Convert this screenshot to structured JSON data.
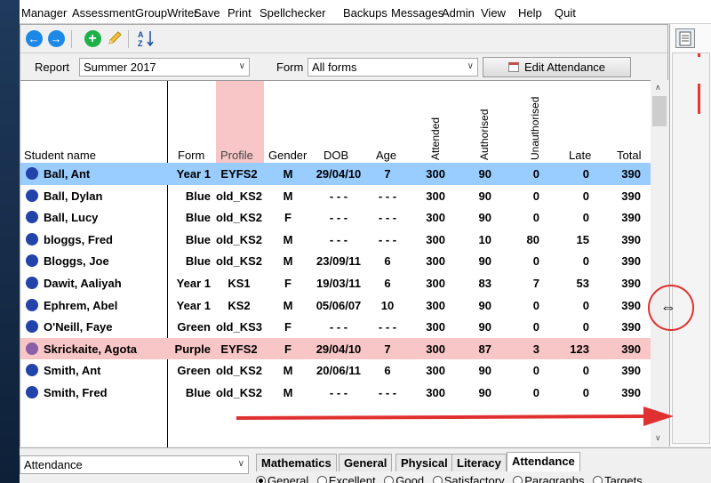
{
  "menu": [
    "Manager",
    "Assessment",
    "GroupWriter",
    "Save",
    "Print",
    "Spellchecker",
    "Backups",
    "Messages",
    "Admin",
    "View",
    "Help",
    "Quit"
  ],
  "filters": {
    "report_label": "Report",
    "report_value": "Summer 2017",
    "form_label": "Form",
    "form_value": "All forms",
    "edit_button": "Edit Attendance"
  },
  "columns": {
    "name": "Student name",
    "form": "Form",
    "profile": "Profile",
    "gender": "Gender",
    "dob": "DOB",
    "age": "Age",
    "attended": "Attended",
    "authorised": "Authorised",
    "unauthorised": "Unauthorised",
    "late": "Late",
    "total": "Total"
  },
  "rows": [
    {
      "name": "Ball, Ant",
      "form": "Year 1",
      "profile": "EYFS2",
      "gender": "M",
      "dob": "29/04/10",
      "age": "7",
      "attended": "300",
      "authorised": "90",
      "unauthorised": "0",
      "late": "0",
      "total": "390"
    },
    {
      "name": "Ball, Dylan",
      "form": "Blue",
      "profile": "old_KS2",
      "gender": "M",
      "dob": "- - -",
      "age": "- - -",
      "attended": "300",
      "authorised": "90",
      "unauthorised": "0",
      "late": "0",
      "total": "390"
    },
    {
      "name": "Ball, Lucy",
      "form": "Blue",
      "profile": "old_KS2",
      "gender": "F",
      "dob": "- - -",
      "age": "- - -",
      "attended": "300",
      "authorised": "90",
      "unauthorised": "0",
      "late": "0",
      "total": "390"
    },
    {
      "name": "bloggs, Fred",
      "form": "Blue",
      "profile": "old_KS2",
      "gender": "M",
      "dob": "- - -",
      "age": "- - -",
      "attended": "300",
      "authorised": "10",
      "unauthorised": "80",
      "late": "15",
      "total": "390"
    },
    {
      "name": "Bloggs, Joe",
      "form": "Blue",
      "profile": "old_KS2",
      "gender": "M",
      "dob": "23/09/11",
      "age": "6",
      "attended": "300",
      "authorised": "90",
      "unauthorised": "0",
      "late": "0",
      "total": "390"
    },
    {
      "name": "Dawit, Aaliyah",
      "form": "Year 1",
      "profile": "KS1",
      "gender": "F",
      "dob": "19/03/11",
      "age": "6",
      "attended": "300",
      "authorised": "83",
      "unauthorised": "7",
      "late": "53",
      "total": "390"
    },
    {
      "name": "Ephrem, Abel",
      "form": "Year 1",
      "profile": "KS2",
      "gender": "M",
      "dob": "05/06/07",
      "age": "10",
      "attended": "300",
      "authorised": "90",
      "unauthorised": "0",
      "late": "0",
      "total": "390"
    },
    {
      "name": "O'Neill, Faye",
      "form": "Green",
      "profile": "old_KS3",
      "gender": "F",
      "dob": "- - -",
      "age": "- - -",
      "attended": "300",
      "authorised": "90",
      "unauthorised": "0",
      "late": "0",
      "total": "390"
    },
    {
      "name": "Skrickaite, Agota",
      "form": "Purple",
      "profile": "EYFS2",
      "gender": "F",
      "dob": "29/04/10",
      "age": "7",
      "attended": "300",
      "authorised": "87",
      "unauthorised": "3",
      "late": "123",
      "total": "390"
    },
    {
      "name": "Smith, Ant",
      "form": "Green",
      "profile": "old_KS2",
      "gender": "M",
      "dob": "20/06/11",
      "age": "6",
      "attended": "300",
      "authorised": "90",
      "unauthorised": "0",
      "late": "0",
      "total": "390"
    },
    {
      "name": "Smith, Fred",
      "form": "Blue",
      "profile": "old_KS2",
      "gender": "M",
      "dob": "- - -",
      "age": "- - -",
      "attended": "300",
      "authorised": "90",
      "unauthorised": "0",
      "late": "0",
      "total": "390"
    }
  ],
  "bottom": {
    "left_select": "Attendance",
    "tabs": [
      "Mathematics",
      "General",
      "Physical",
      "Literacy",
      "Attendance"
    ],
    "radios": [
      "General",
      "Excellent",
      "Good",
      "Satisfactory",
      "Paragraphs",
      "Targets"
    ]
  },
  "colors": {
    "selected_row": "#99ccff",
    "highlight_row": "#f8c6c6",
    "student_dot": "#2244aa",
    "student_dot_alt": "#8a5fa8",
    "annotation": "#e03030"
  }
}
